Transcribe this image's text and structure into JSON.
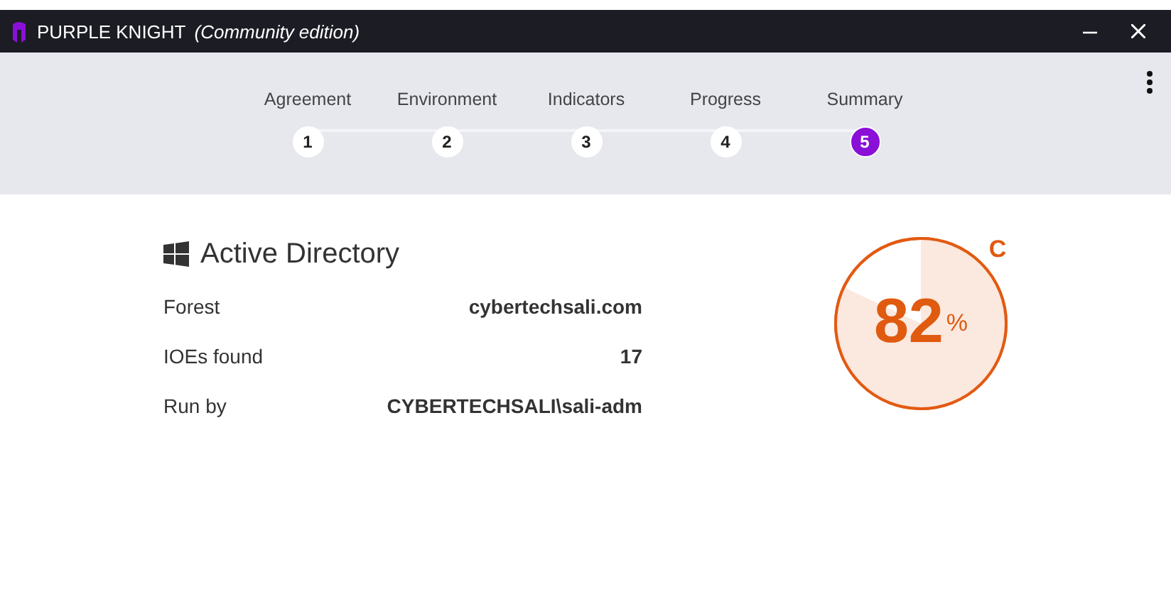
{
  "window": {
    "title": "PURPLE KNIGHT",
    "subtitle": "(Community edition)"
  },
  "steps": [
    {
      "label": "Agreement",
      "number": "1",
      "selected": false
    },
    {
      "label": "Environment",
      "number": "2",
      "selected": false
    },
    {
      "label": "Indicators",
      "number": "3",
      "selected": false
    },
    {
      "label": "Progress",
      "number": "4",
      "selected": false
    },
    {
      "label": "Summary",
      "number": "5",
      "selected": true
    }
  ],
  "summary": {
    "heading": "Active Directory",
    "rows": [
      {
        "label": "Forest",
        "value": "cybertechsali.com"
      },
      {
        "label": "IOEs found",
        "value": "17"
      },
      {
        "label": "Run by",
        "value": "CYBERTECHSALI\\sali-adm"
      }
    ]
  },
  "score": {
    "value": "82",
    "unit": "%",
    "grade": "C"
  }
}
